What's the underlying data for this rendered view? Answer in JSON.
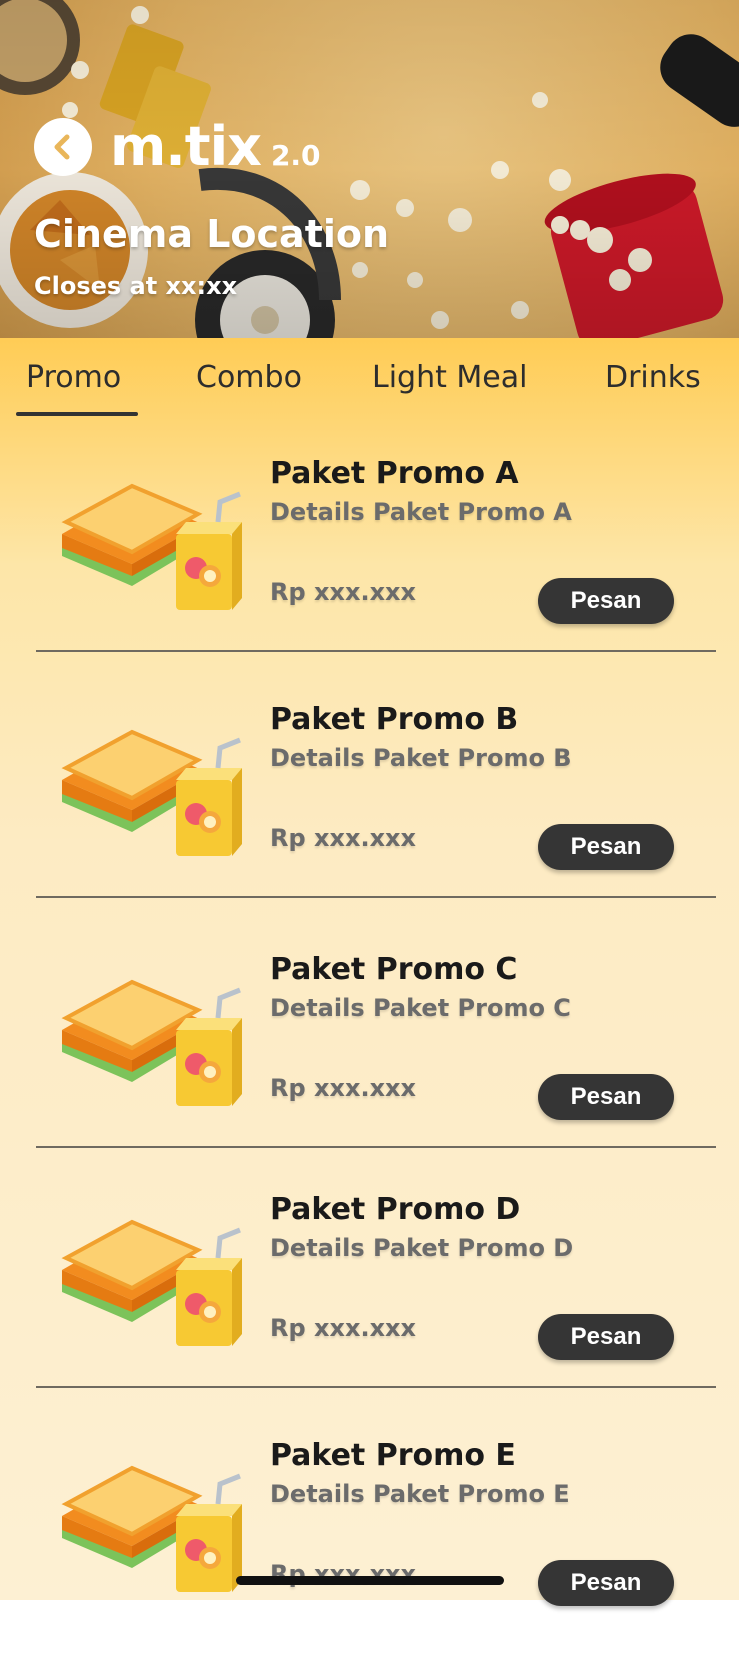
{
  "header": {
    "logo_text": "m.tix",
    "logo_version": "2.0",
    "cinema_title": "Cinema Location",
    "closes_text": "Closes at xx:xx",
    "back_icon": "chevron-left-icon"
  },
  "tabs": [
    {
      "label": "Promo",
      "active": true
    },
    {
      "label": "Combo",
      "active": false
    },
    {
      "label": "Light Meal",
      "active": false
    },
    {
      "label": "Drinks",
      "active": false
    }
  ],
  "items": [
    {
      "name": "Paket Promo A",
      "details": "Details Paket Promo A",
      "price": "Rp xxx.xxx",
      "button": "Pesan"
    },
    {
      "name": "Paket Promo B",
      "details": "Details Paket Promo B",
      "price": "Rp xxx.xxx",
      "button": "Pesan"
    },
    {
      "name": "Paket Promo C",
      "details": "Details Paket Promo C",
      "price": "Rp xxx.xxx",
      "button": "Pesan"
    },
    {
      "name": "Paket Promo D",
      "details": "Details Paket Promo D",
      "price": "Rp xxx.xxx",
      "button": "Pesan"
    },
    {
      "name": "Paket Promo E",
      "details": "Details Paket Promo E",
      "price": "Rp xxx.xxx",
      "button": "Pesan"
    }
  ],
  "colors": {
    "accent_yellow": "#ffcc55",
    "button_dark": "#353535",
    "text_dark": "#1a1a1a",
    "text_muted": "#6b6b6b"
  }
}
